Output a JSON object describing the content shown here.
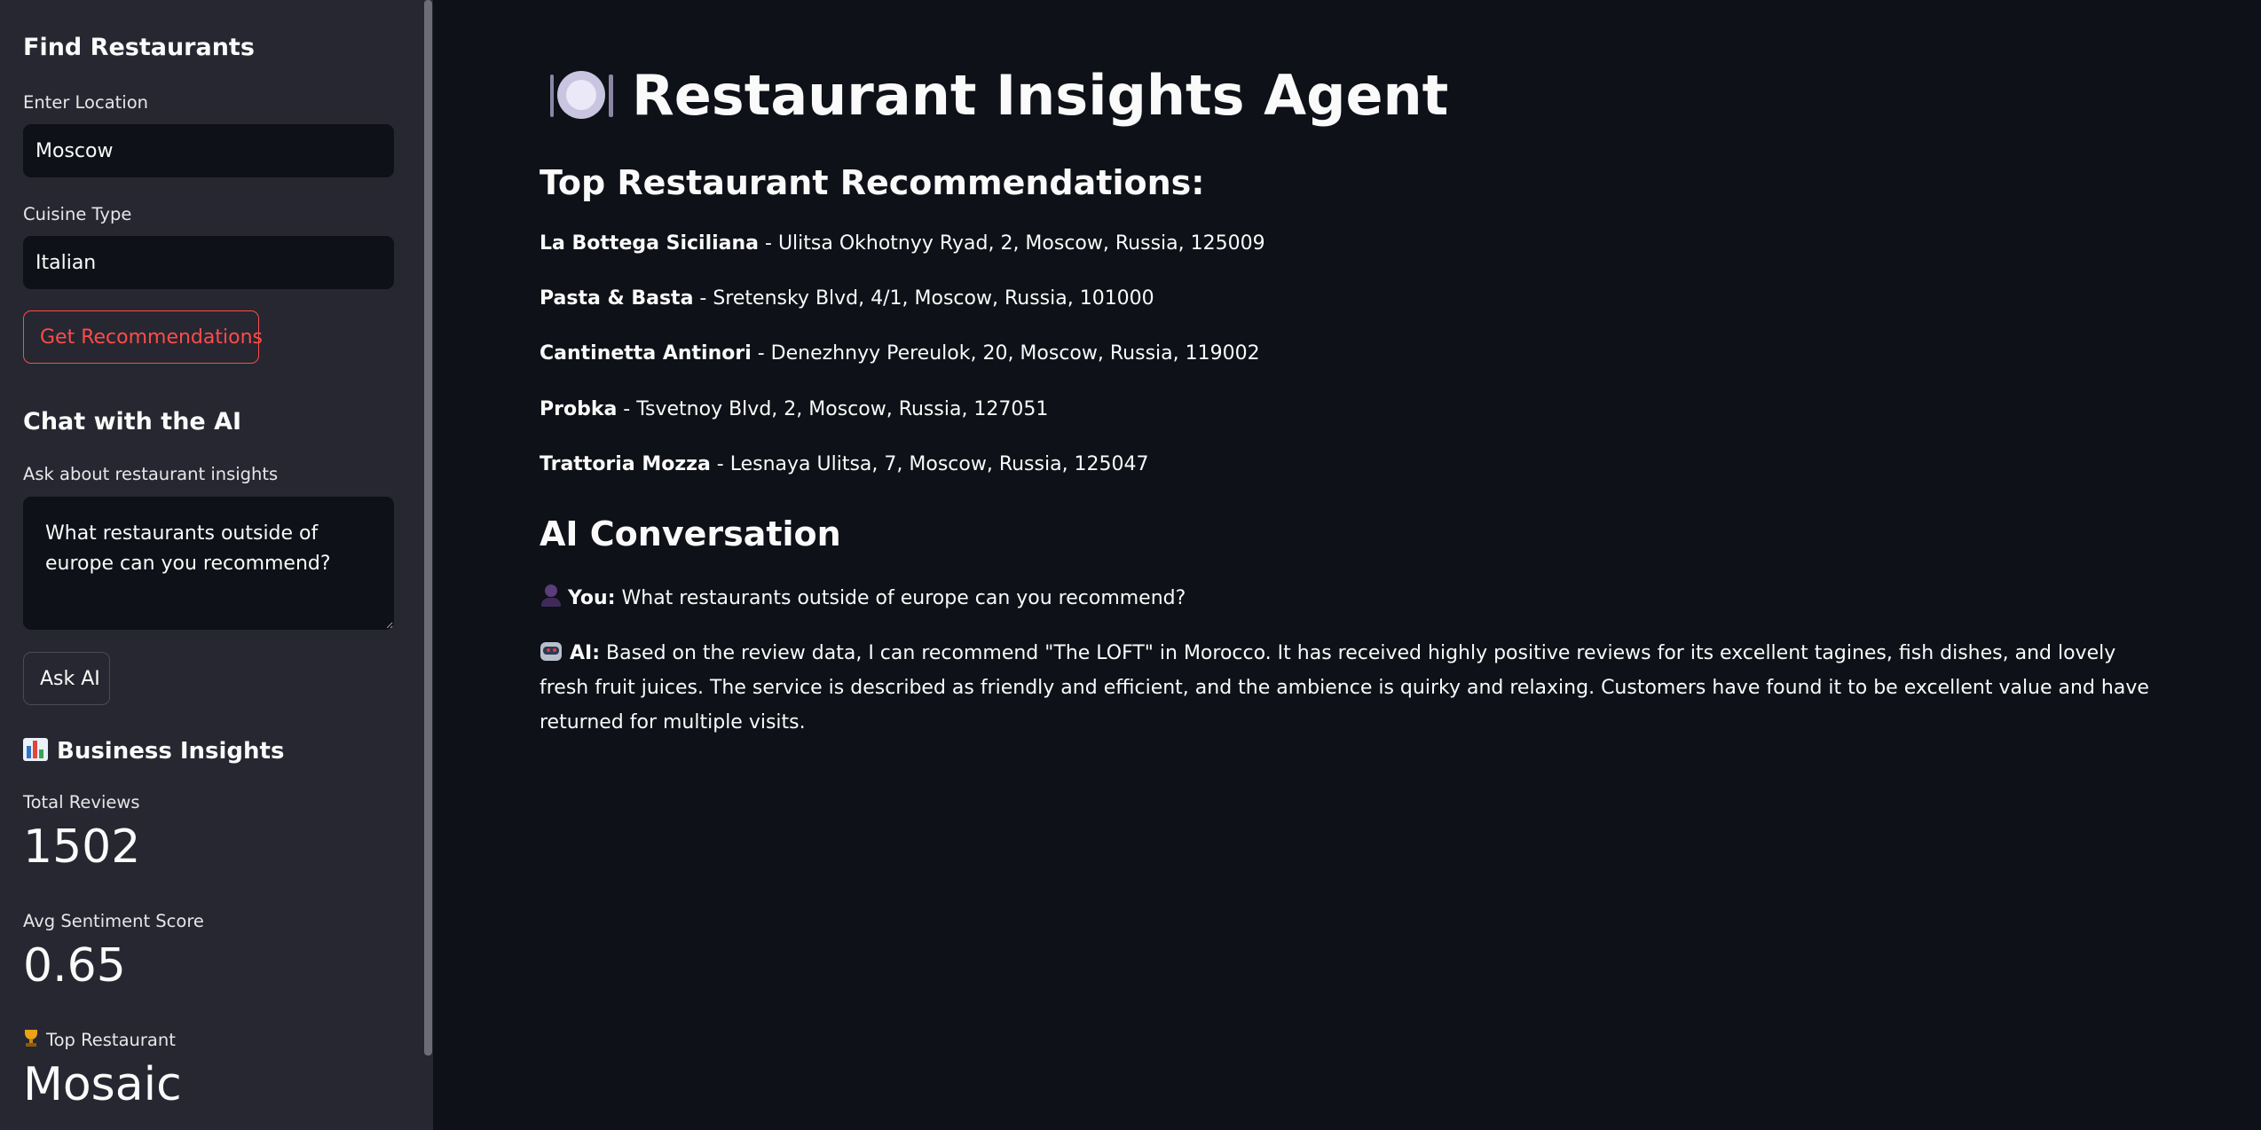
{
  "sidebar": {
    "find_heading": "Find Restaurants",
    "location_label": "Enter Location",
    "location_value": "Moscow",
    "cuisine_label": "Cuisine Type",
    "cuisine_value": "Italian",
    "recommend_button": "Get Recommendations",
    "chat_heading": "Chat with the AI",
    "ask_label": "Ask about restaurant insights",
    "ask_value": "What restaurants outside of europe can you recommend?",
    "ask_button": "Ask AI",
    "insights_heading": "Business Insights",
    "insights_icon": "bar-chart-icon",
    "metrics": {
      "total_reviews_label": "Total Reviews",
      "total_reviews_value": "1502",
      "avg_sentiment_label": "Avg Sentiment Score",
      "avg_sentiment_value": "0.65",
      "top_restaurant_label": "Top Restaurant",
      "top_restaurant_icon": "trophy-icon",
      "top_restaurant_value": "Mosaic"
    }
  },
  "main": {
    "title": "Restaurant Insights Agent",
    "title_icon": "plate-cutlery-icon",
    "recommendations_heading": "Top Restaurant Recommendations:",
    "recommendations": [
      {
        "name": "La Bottega Siciliana",
        "address": " - Ulitsa Okhotnyy Ryad, 2, Moscow, Russia, 125009"
      },
      {
        "name": "Pasta & Basta",
        "address": " - Sretensky Blvd, 4/1, Moscow, Russia, 101000"
      },
      {
        "name": "Cantinetta Antinori",
        "address": " - Denezhnyy Pereulok, 20, Moscow, Russia, 119002"
      },
      {
        "name": "Probka",
        "address": " - Tsvetnoy Blvd, 2, Moscow, Russia, 127051"
      },
      {
        "name": "Trattoria Mozza",
        "address": " - Lesnaya Ulitsa, 7, Moscow, Russia, 125047"
      }
    ],
    "conversation_heading": "AI Conversation",
    "conversation": [
      {
        "speaker": "You:",
        "icon": "user-icon",
        "text": " What restaurants outside of europe can you recommend?"
      },
      {
        "speaker": "AI:",
        "icon": "robot-icon",
        "text": " Based on the review data, I can recommend \"The LOFT\" in Morocco. It has received highly positive reviews for its excellent tagines, fish dishes, and lovely fresh fruit juices. The service is described as friendly and efficient, and the ambience is quirky and relaxing. Customers have found it to be excellent value and have returned for multiple visits."
      }
    ]
  },
  "colors": {
    "sidebar_bg": "#262730",
    "main_bg": "#0e1117",
    "accent": "#ff4b4b",
    "text": "#fafafa"
  }
}
